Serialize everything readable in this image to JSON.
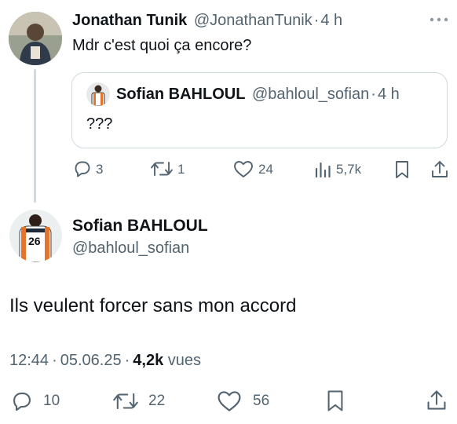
{
  "reply_tweet": {
    "author_name": "Jonathan Tunik",
    "author_handle": "@JonathanTunik",
    "separator": "·",
    "time": "4 h",
    "text": "Mdr c'est quoi ça encore?",
    "avatar_icon": "person-avatar-icon",
    "more_icon": "more-dots-icon",
    "actions": {
      "replies": "3",
      "retweets": "1",
      "likes": "24",
      "views": "5,7k"
    }
  },
  "quoted_tweet": {
    "author_name": "Sofian BAHLOUL",
    "author_handle": "@bahloul_sofian",
    "separator": "·",
    "time": "4 h",
    "text": "???"
  },
  "main_tweet": {
    "author_name": "Sofian BAHLOUL",
    "author_handle": "@bahloul_sofian",
    "jersey_number": "26",
    "text": "Ils veulent forcer sans mon accord",
    "time": "12:44",
    "separator": "·",
    "date": "05.06.25",
    "separator2": "·",
    "views_count": "4,2k",
    "views_label": "vues",
    "actions": {
      "replies": "10",
      "retweets": "22",
      "likes": "56"
    }
  },
  "colors": {
    "text": "#0f1419",
    "muted": "#536471",
    "border": "#cfd9de",
    "thread_line": "#cfd9de"
  }
}
